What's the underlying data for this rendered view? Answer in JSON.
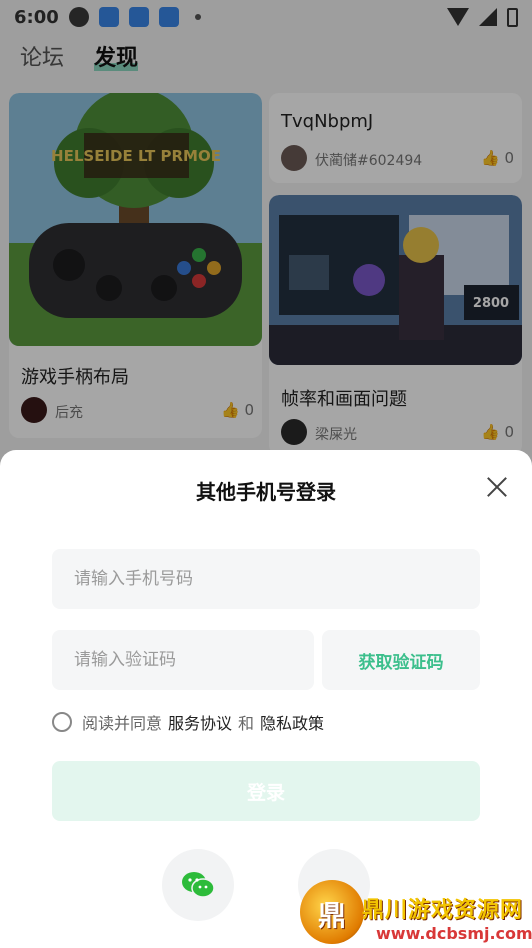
{
  "status_bar": {
    "time": "6:00"
  },
  "tabs": [
    {
      "label": "论坛"
    },
    {
      "label": "发现"
    }
  ],
  "feed": {
    "cards": [
      {
        "title": "游戏手柄布局",
        "author": "后充",
        "likes": "0",
        "image_text": "HELSEIDE LT PRMOE"
      },
      {
        "title": "TvqNbpmJ",
        "author": "伏蔺储#602494",
        "likes": "0"
      },
      {
        "title": "帧率和画面问题",
        "author": "梁屎光",
        "likes": "0",
        "image_text": "2800"
      }
    ]
  },
  "login_sheet": {
    "title": "其他手机号登录",
    "phone_placeholder": "请输入手机号码",
    "code_placeholder": "请输入验证码",
    "get_code_label": "获取验证码",
    "agree_prefix": "阅读并同意",
    "service_agreement": "服务协议",
    "and": "和",
    "privacy_policy": "隐私政策",
    "login_label": "登录"
  },
  "watermark": {
    "text": "鼎川游戏资源网",
    "url": "www.dcbsmj.com",
    "logo_char": "鼎"
  },
  "colors": {
    "accent": "#3cbf8c",
    "login_disabled_bg": "#e3f6ee",
    "tab_highlight": "#47c7a0"
  }
}
